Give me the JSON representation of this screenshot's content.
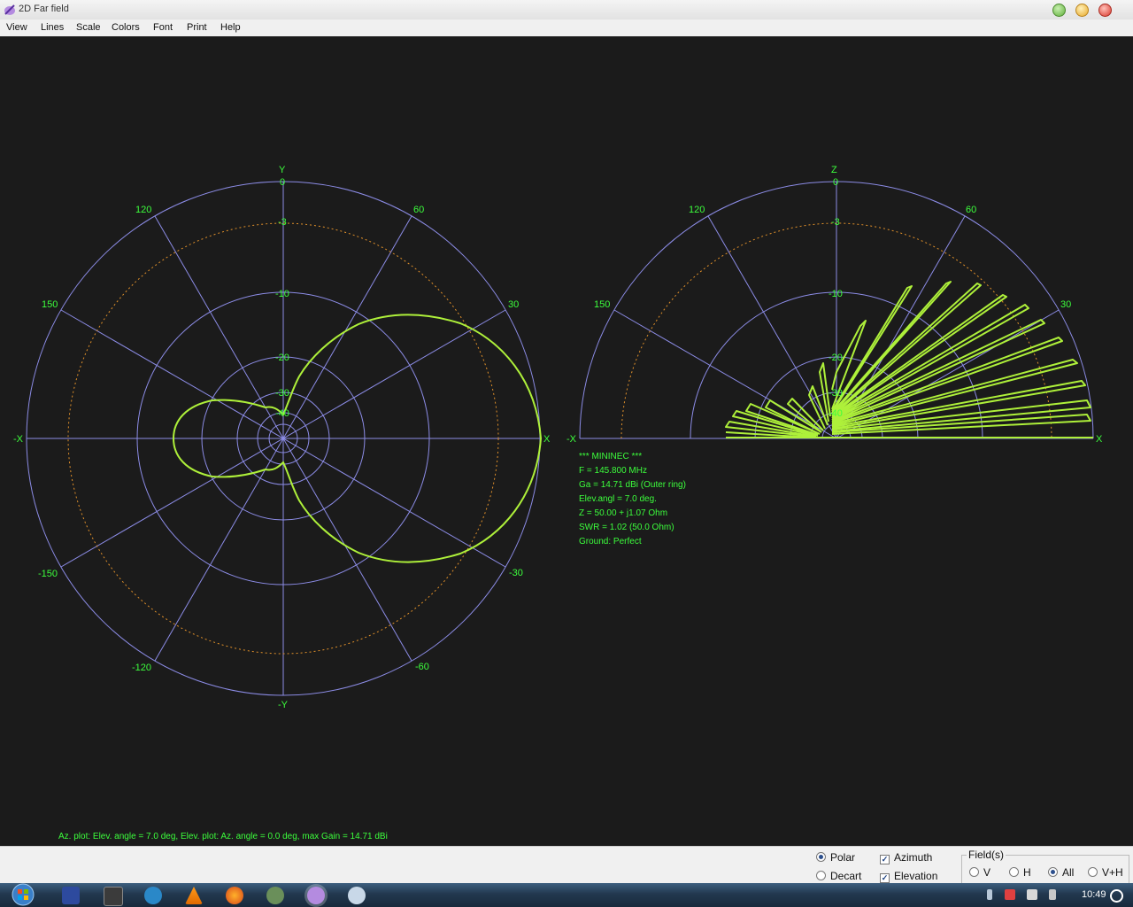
{
  "window": {
    "title": "2D Far field"
  },
  "menu": [
    "View",
    "Lines",
    "Scale",
    "Colors",
    "Font",
    "Print",
    "Help"
  ],
  "colors": {
    "background": "#1b1b1b",
    "grid": "#8c8ce6",
    "ref_ring": "#e0902a",
    "trace": "#aef03a",
    "label": "#3cff3c"
  },
  "azimuth_plot": {
    "axis_top": "Y",
    "axis_bottom": "-Y",
    "axis_left": "-X",
    "axis_right": "X",
    "angle_labels": {
      "a120": "120",
      "a60": "60",
      "a150": "150",
      "a30": "30",
      "am150": "-150",
      "am30": "-30",
      "am120": "-120",
      "am60": "-60"
    },
    "ring_labels": {
      "r0": "0",
      "r3": "-3",
      "r10": "-10",
      "r20": "-20",
      "r30": "-30",
      "r40": "-40"
    }
  },
  "elevation_plot": {
    "axis_top": "Z",
    "axis_left": "-X",
    "axis_right": "X",
    "angle_labels": {
      "a120": "120",
      "a60": "60",
      "a150": "150",
      "a30": "30"
    },
    "ring_labels": {
      "r0": "0",
      "r3": "-3",
      "r10": "-10",
      "r20": "-20",
      "r30": "-30",
      "r40": "-40"
    }
  },
  "info": {
    "engine": "*** MININEC ***",
    "freq": "F = 145.800 MHz",
    "gain": "Ga = 14.71 dBi (Outer ring)",
    "elev": "Elev.angl = 7.0 deg.",
    "impedance": "Z = 50.00 + j1.07 Ohm",
    "swr": "SWR = 1.02 (50.0 Ohm)",
    "ground": "Ground: Perfect"
  },
  "status_text": "Az. plot: Elev. angle = 7.0 deg,  Elev. plot: Az. angle = 0.0 deg, max Gain = 14.71 dBi",
  "controls": {
    "polar": "Polar",
    "decart": "Decart",
    "azimuth": "Azimuth",
    "elevation": "Elevation",
    "fields_title": "Field(s)",
    "v": "V",
    "h": "H",
    "all": "All",
    "vh": "V+H"
  },
  "clock": "10:49"
}
